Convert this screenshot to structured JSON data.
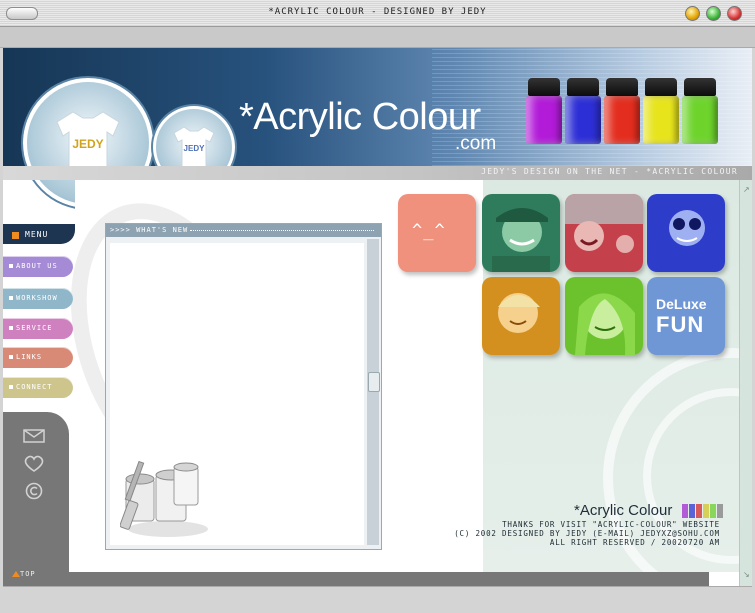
{
  "window": {
    "title": "*ACRYLIC COLOUR - DESIGNED BY JEDY"
  },
  "header": {
    "brand": "*Acrylic Colour",
    "brand_suffix": ".com",
    "tagline": "JEDY'S DESIGN ON THE NET - *ACRYLIC COLOUR",
    "bottle_colors": [
      "#b21bd8",
      "#2d2fd6",
      "#e32d1f",
      "#e7e41c",
      "#6ed42c"
    ]
  },
  "nav": {
    "menu_label": "MENU",
    "items": [
      {
        "label": "ABOUT US",
        "color": "#a58ad6"
      },
      {
        "label": "WORKSHOW",
        "color": "#8fb7c9"
      },
      {
        "label": "SERVICE",
        "color": "#cf80bf"
      },
      {
        "label": "LINKS",
        "color": "#d98a76"
      },
      {
        "label": "CONNECT",
        "color": "#cec58c"
      }
    ],
    "side_icons": [
      "mail-icon",
      "heart-icon",
      "copyright-icon"
    ],
    "top_label": "TOP"
  },
  "news": {
    "title": ">>>> WHAT'S NEW"
  },
  "tiles": {
    "smile_text": "^_^",
    "deluxe_line1": "DeLuxe",
    "deluxe_line2": "FUN",
    "photo_colors": [
      "#2f7c5c",
      "#c4404a",
      "#2d3cc9",
      "#d4901e",
      "#6cc22c"
    ]
  },
  "footer": {
    "logo": "*Acrylic Colour",
    "line1": "THANKS FOR VISIT \"ACRYLIC-COLOUR\" WEBSITE",
    "line2": "(C) 2002 DESIGNED BY JEDY (E-MAIL) JEDYXZ@SOHU.COM",
    "line3": "ALL RIGHT RESERVED / 20020720 AM"
  }
}
